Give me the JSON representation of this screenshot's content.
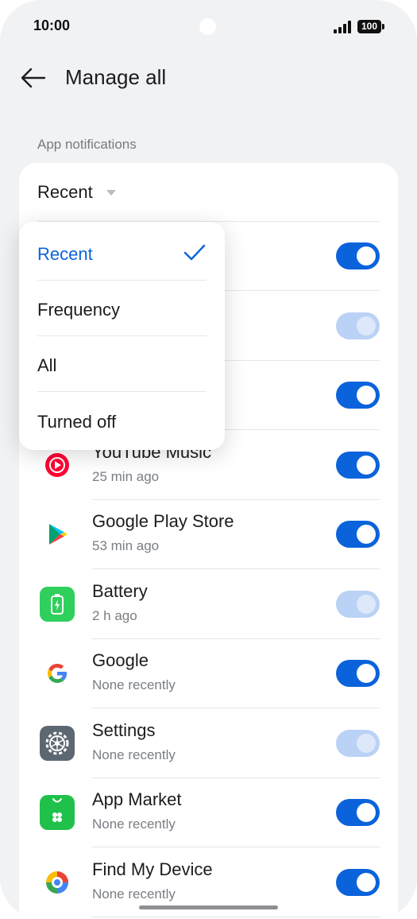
{
  "status_bar": {
    "time": "10:00",
    "battery": "100",
    "icons": [
      "signal-icon",
      "battery-icon"
    ]
  },
  "header": {
    "title": "Manage all",
    "back_icon": "back-arrow-icon"
  },
  "section_label": "App notifications",
  "sort": {
    "selected": "Recent"
  },
  "dropdown": {
    "options": [
      {
        "label": "Recent",
        "selected": true
      },
      {
        "label": "Frequency",
        "selected": false
      },
      {
        "label": "All",
        "selected": false
      },
      {
        "label": "Turned off",
        "selected": false
      }
    ]
  },
  "apps": [
    {
      "name": "",
      "subtitle": "",
      "icon": "hidden-app-icon",
      "enabled": true,
      "editable": true
    },
    {
      "name": "",
      "subtitle": "",
      "icon": "hidden-app-icon",
      "enabled": true,
      "editable": false
    },
    {
      "name": "",
      "subtitle": "",
      "icon": "hidden-app-icon",
      "enabled": true,
      "editable": true
    },
    {
      "name": "YouTube Music",
      "subtitle": "25 min ago",
      "icon": "youtube-music-icon",
      "enabled": true,
      "editable": true
    },
    {
      "name": "Google Play Store",
      "subtitle": "53 min ago",
      "icon": "play-store-icon",
      "enabled": true,
      "editable": true
    },
    {
      "name": "Battery",
      "subtitle": "2 h ago",
      "icon": "battery-app-icon",
      "enabled": true,
      "editable": false
    },
    {
      "name": "Google",
      "subtitle": "None recently",
      "icon": "google-icon",
      "enabled": true,
      "editable": true
    },
    {
      "name": "Settings",
      "subtitle": "None recently",
      "icon": "settings-gear-icon",
      "enabled": true,
      "editable": false
    },
    {
      "name": "App Market",
      "subtitle": "None recently",
      "icon": "app-market-icon",
      "enabled": true,
      "editable": true
    },
    {
      "name": "Find My Device",
      "subtitle": "None recently",
      "icon": "find-my-device-icon",
      "enabled": true,
      "editable": true
    }
  ],
  "colors": {
    "accent": "#0b63db",
    "accent_disabled": "#b9d2f5",
    "background": "#f1f2f4",
    "card": "#ffffff"
  }
}
